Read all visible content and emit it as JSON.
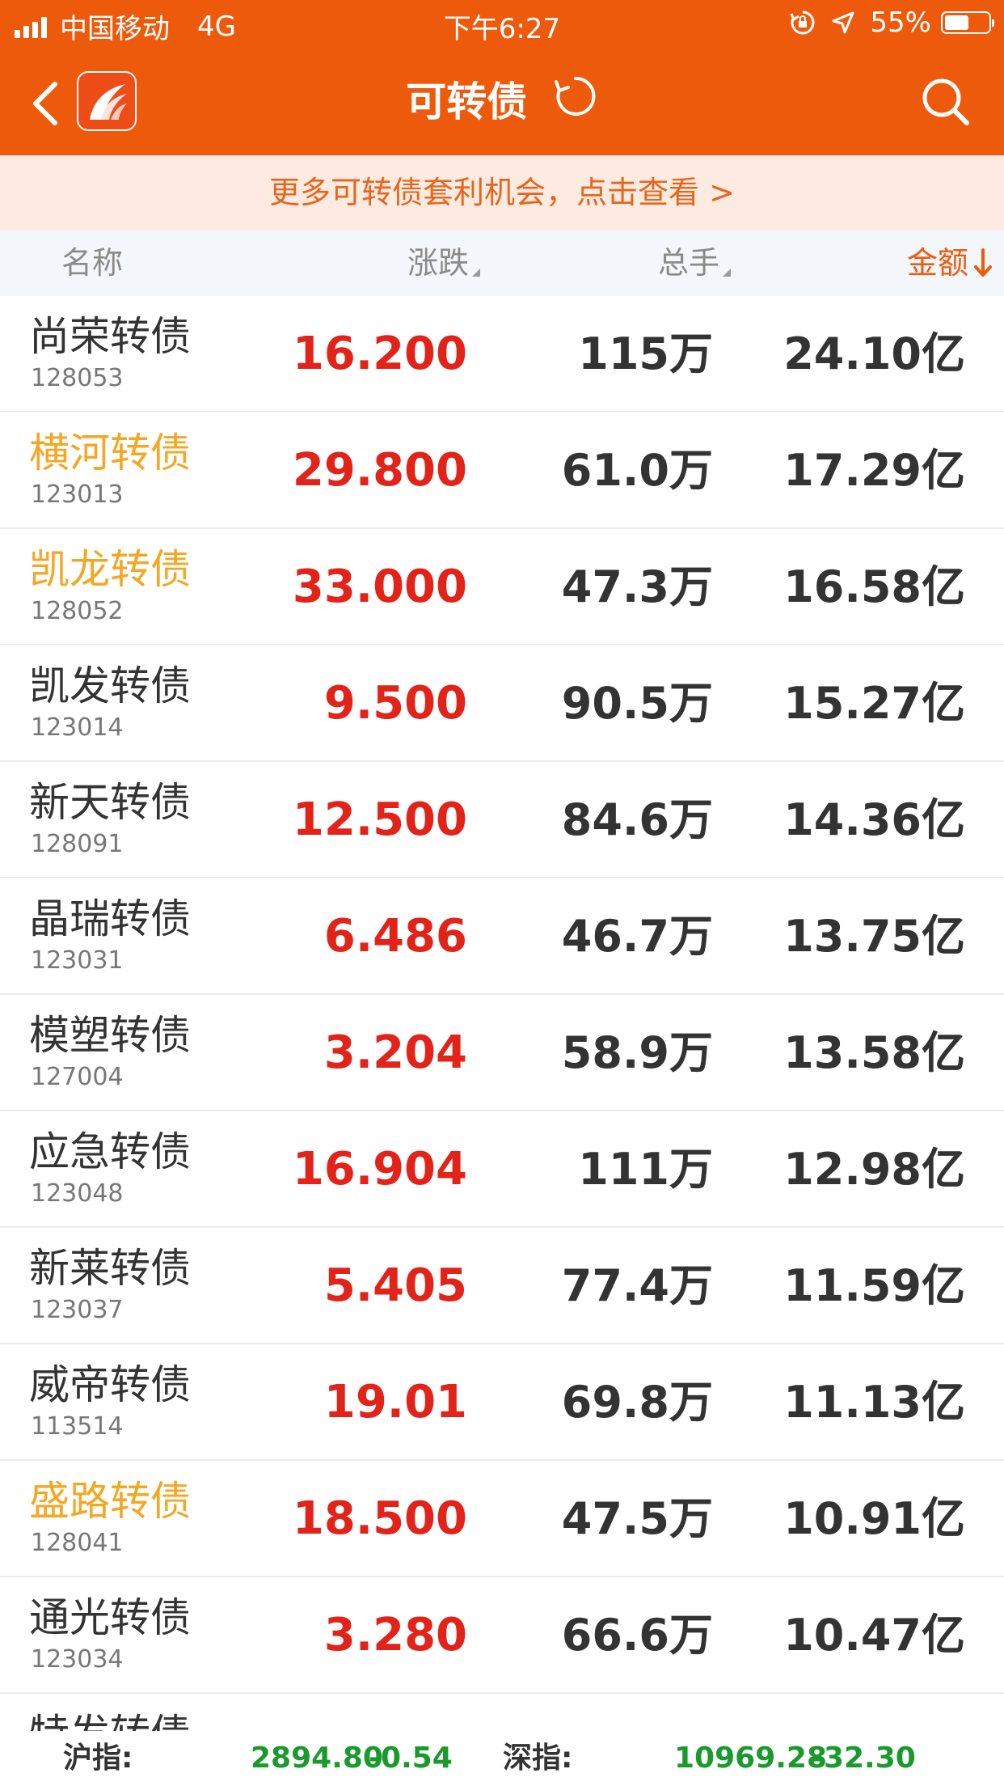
{
  "status_bar": {
    "carrier": "中国移动",
    "network": "4G",
    "time": "下午6:27",
    "battery": "55%",
    "battery_level": 0.55
  },
  "nav": {
    "title": "可转债"
  },
  "promo": {
    "text": "更多可转债套利机会，点击查看 >"
  },
  "columns": {
    "name": "名称",
    "change": "涨跌",
    "volume": "总手",
    "amount": "金额"
  },
  "rows": [
    {
      "name": "尚荣转债",
      "code": "128053",
      "change": "16.200",
      "volume": "115万",
      "amount": "24.10亿",
      "highlight": false
    },
    {
      "name": "横河转债",
      "code": "123013",
      "change": "29.800",
      "volume": "61.0万",
      "amount": "17.29亿",
      "highlight": true
    },
    {
      "name": "凯龙转债",
      "code": "128052",
      "change": "33.000",
      "volume": "47.3万",
      "amount": "16.58亿",
      "highlight": true
    },
    {
      "name": "凯发转债",
      "code": "123014",
      "change": "9.500",
      "volume": "90.5万",
      "amount": "15.27亿",
      "highlight": false
    },
    {
      "name": "新天转债",
      "code": "128091",
      "change": "12.500",
      "volume": "84.6万",
      "amount": "14.36亿",
      "highlight": false
    },
    {
      "name": "晶瑞转债",
      "code": "123031",
      "change": "6.486",
      "volume": "46.7万",
      "amount": "13.75亿",
      "highlight": false
    },
    {
      "name": "模塑转债",
      "code": "127004",
      "change": "3.204",
      "volume": "58.9万",
      "amount": "13.58亿",
      "highlight": false
    },
    {
      "name": "应急转债",
      "code": "123048",
      "change": "16.904",
      "volume": "111万",
      "amount": "12.98亿",
      "highlight": false
    },
    {
      "name": "新莱转债",
      "code": "123037",
      "change": "5.405",
      "volume": "77.4万",
      "amount": "11.59亿",
      "highlight": false
    },
    {
      "name": "威帝转债",
      "code": "113514",
      "change": "19.01",
      "volume": "69.8万",
      "amount": "11.13亿",
      "highlight": false
    },
    {
      "name": "盛路转债",
      "code": "128041",
      "change": "18.500",
      "volume": "47.5万",
      "amount": "10.91亿",
      "highlight": true
    },
    {
      "name": "通光转债",
      "code": "123034",
      "change": "3.280",
      "volume": "66.6万",
      "amount": "10.47亿",
      "highlight": false
    },
    {
      "name": "特发转债",
      "code": "",
      "change": "",
      "volume": "",
      "amount": "",
      "highlight": false
    }
  ],
  "index_bar": {
    "sh_label": "沪指:",
    "sh_value": "2894.80",
    "sh_change": "-0.54",
    "sz_label": "深指:",
    "sz_value": "10969.28",
    "sz_change": "-32.30"
  },
  "colors": {
    "brand": "#ee5a0c",
    "up": "#e2231a",
    "highlight_name": "#f5a623",
    "index_down": "#1a9a2c"
  },
  "icons": {
    "back": "chevron-left-icon",
    "logo": "app-logo-icon",
    "refresh": "refresh-icon",
    "search": "search-icon",
    "sort": "sort-triangle-icon",
    "sort_active": "arrow-down-icon"
  }
}
